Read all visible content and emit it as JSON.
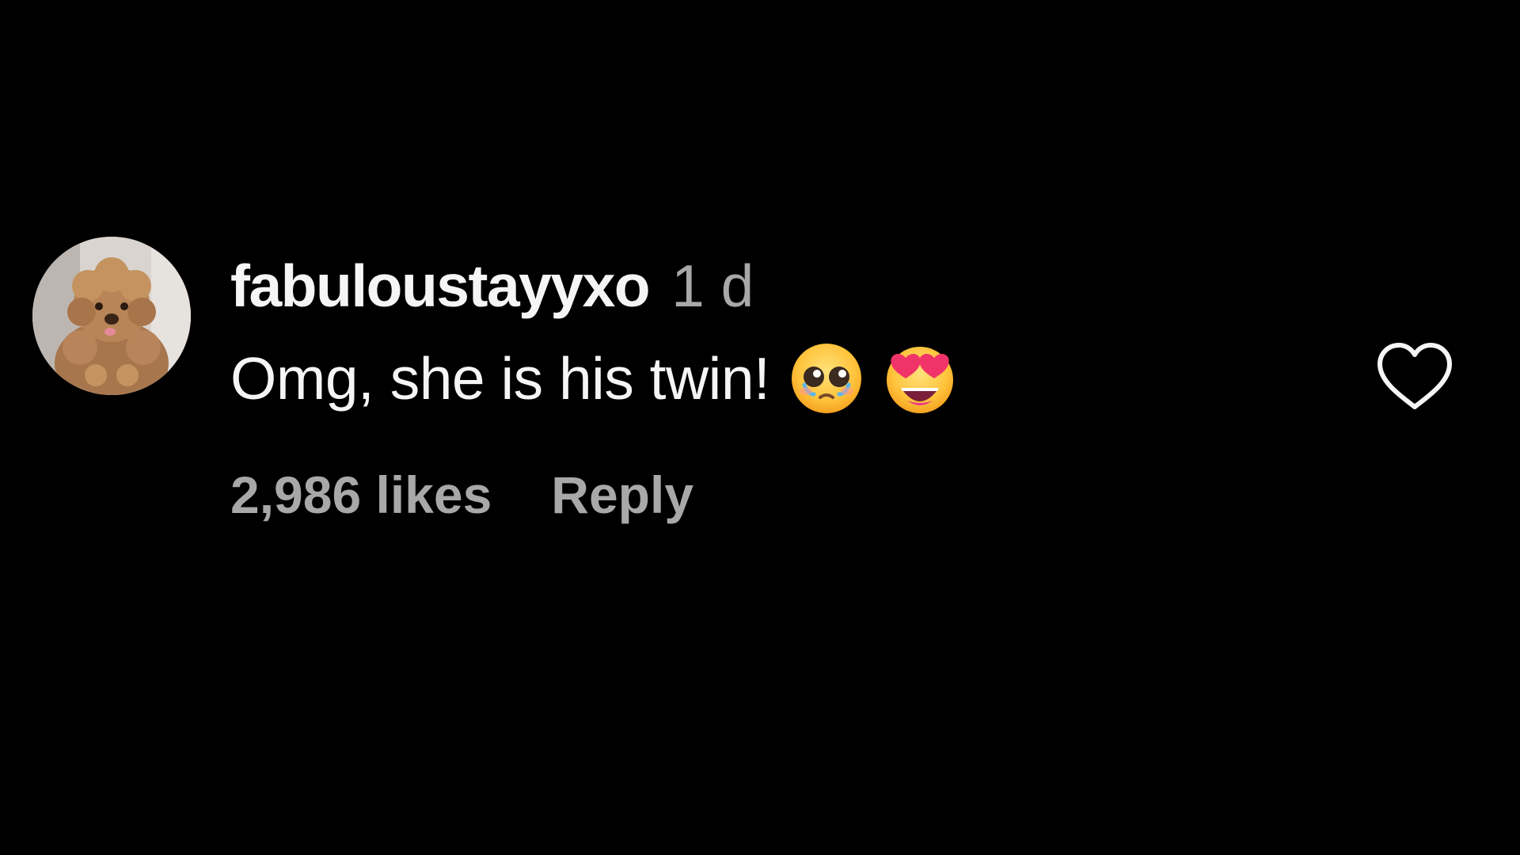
{
  "comment": {
    "avatar_icon": "poodle-avatar",
    "username": "fabuloustayyxo",
    "timestamp": "1 d",
    "text": "Omg, she is his twin!",
    "emojis": [
      "pleading-face-tears-icon",
      "heart-eyes-icon"
    ],
    "likes": "2,986 likes",
    "reply_label": "Reply",
    "like_icon": "heart-outline-icon"
  },
  "colors": {
    "background": "#000000",
    "primary_text": "#f5f5f5",
    "secondary_text": "#a8a8a8"
  }
}
